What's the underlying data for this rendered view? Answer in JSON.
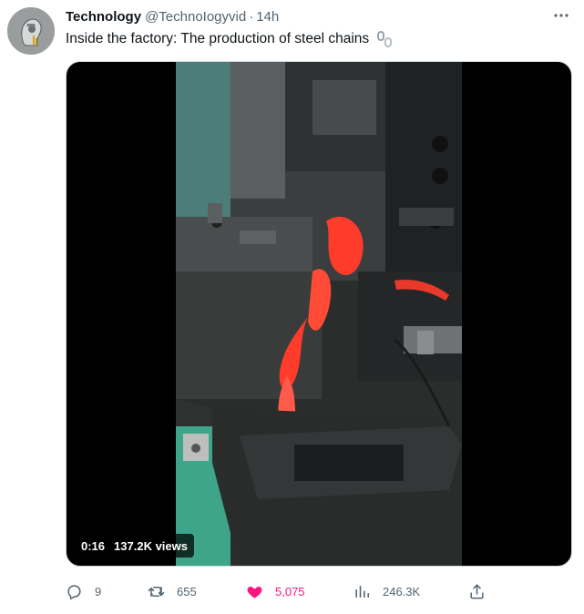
{
  "author": {
    "name": "Technology",
    "handle": "@TechnoIogyvid",
    "separator": "·",
    "time": "14h"
  },
  "tweet": {
    "text": "Inside the factory: The production of steel chains",
    "emoji_icon": "chain-link-icon"
  },
  "media": {
    "duration": "0:16",
    "views_label": "137.2K views"
  },
  "actions": {
    "replies": "9",
    "retweets": "655",
    "likes": "5,075",
    "views": "246.3K"
  },
  "colors": {
    "like_active": "#f91880",
    "secondary_text": "#536471",
    "primary_text": "#0f1419",
    "hot_metal": "#ff3b2b",
    "machine_green": "#3fa58a"
  },
  "icons": {
    "more": "more-dots-icon",
    "reply": "reply-icon",
    "retweet": "retweet-icon",
    "like": "heart-filled-icon",
    "views": "views-bar-chart-icon",
    "share": "share-upload-icon"
  }
}
